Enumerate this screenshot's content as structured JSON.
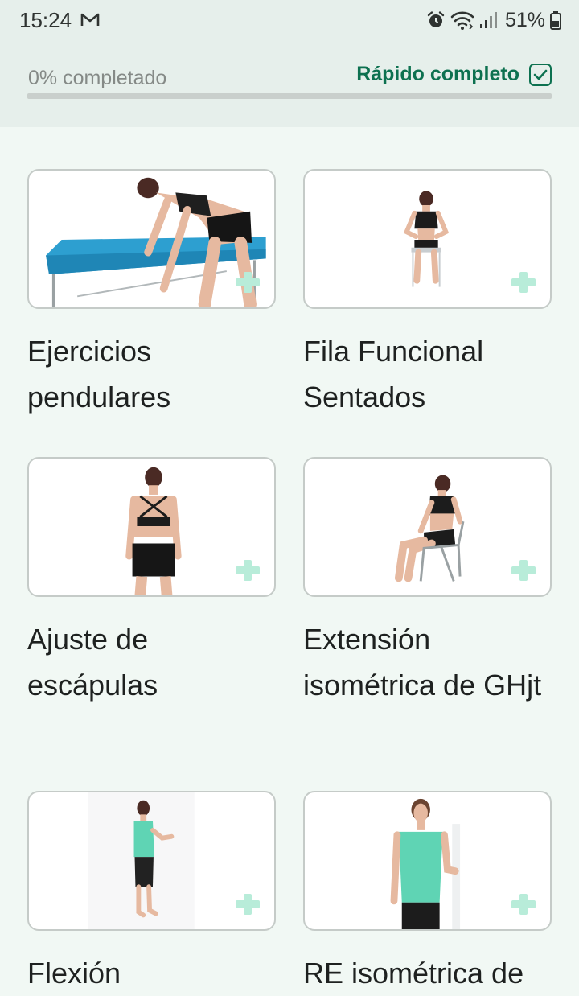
{
  "status_bar": {
    "time": "15:24",
    "notification_icon": "gmail-icon",
    "alarm_icon": "alarm-icon",
    "wifi_icon": "wifi-icon",
    "signal_icon": "signal-icon",
    "battery_text": "51%",
    "battery_icon": "battery-icon"
  },
  "progress": {
    "label": "0% completado",
    "value": 0,
    "quick_complete_label": "Rápido completo",
    "quick_complete_checked": true
  },
  "colors": {
    "accent": "#0d7150",
    "plus_icon": "#b8ecd9",
    "background": "#f1f8f4",
    "header": "#e6efeb"
  },
  "exercises": [
    {
      "title": "Ejercicios pendulares",
      "image": "pendular-exercise-table",
      "add_icon": "plus-icon"
    },
    {
      "title": "Fila Funcional Sentados",
      "image": "seated-row",
      "add_icon": "plus-icon"
    },
    {
      "title": "Ajuste de escápulas",
      "image": "scapular-squeeze",
      "add_icon": "plus-icon"
    },
    {
      "title": "Extensión isométrica de GHjt",
      "image": "seated-isometric-extension",
      "add_icon": "plus-icon"
    },
    {
      "title": "Flexión",
      "image": "wall-flexion",
      "add_icon": "plus-icon"
    },
    {
      "title": "RE isométrica de",
      "image": "isometric-external-rotation",
      "add_icon": "plus-icon"
    }
  ]
}
